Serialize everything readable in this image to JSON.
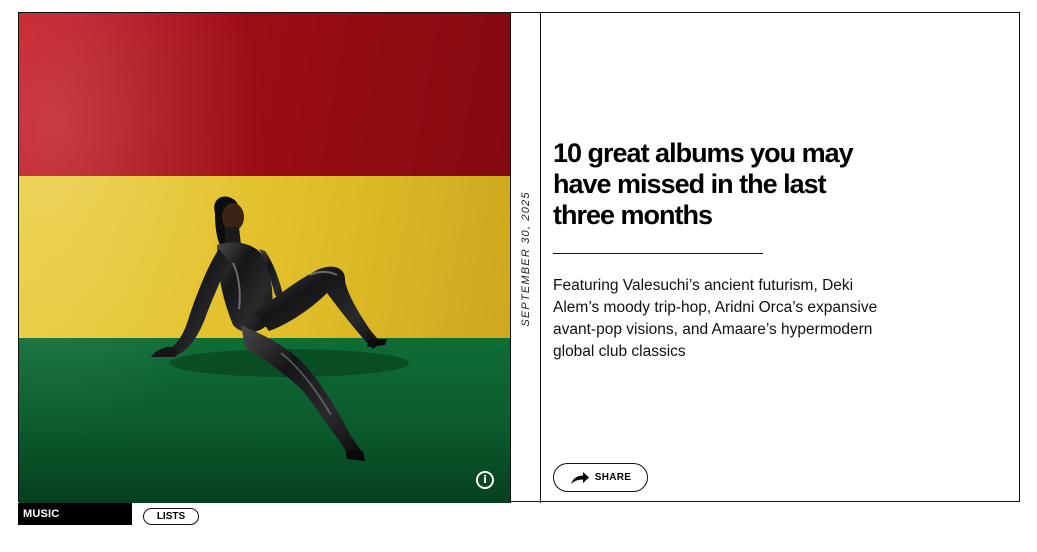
{
  "article": {
    "date": "SEPTEMBER 30, 2025",
    "headline": "10 great albums you may have missed in the last three months",
    "dek": "Featuring Valesuchi’s ancient futurism, Deki Alem’s moody trip-hop, Aridni Orca’s expansive avant-pop visions, and Amaare’s hypermodern global club classics",
    "share_label": "SHARE",
    "info_icon_glyph": "i"
  },
  "tags": {
    "primary": "MUSIC",
    "secondary": "LISTS"
  },
  "icons": {
    "info": "info-icon",
    "share": "share-arrow-icon"
  },
  "colors": {
    "flag_red": "#b01018",
    "flag_yellow": "#e3c12c",
    "flag_green": "#0b5a2c",
    "ink": "#111111"
  }
}
